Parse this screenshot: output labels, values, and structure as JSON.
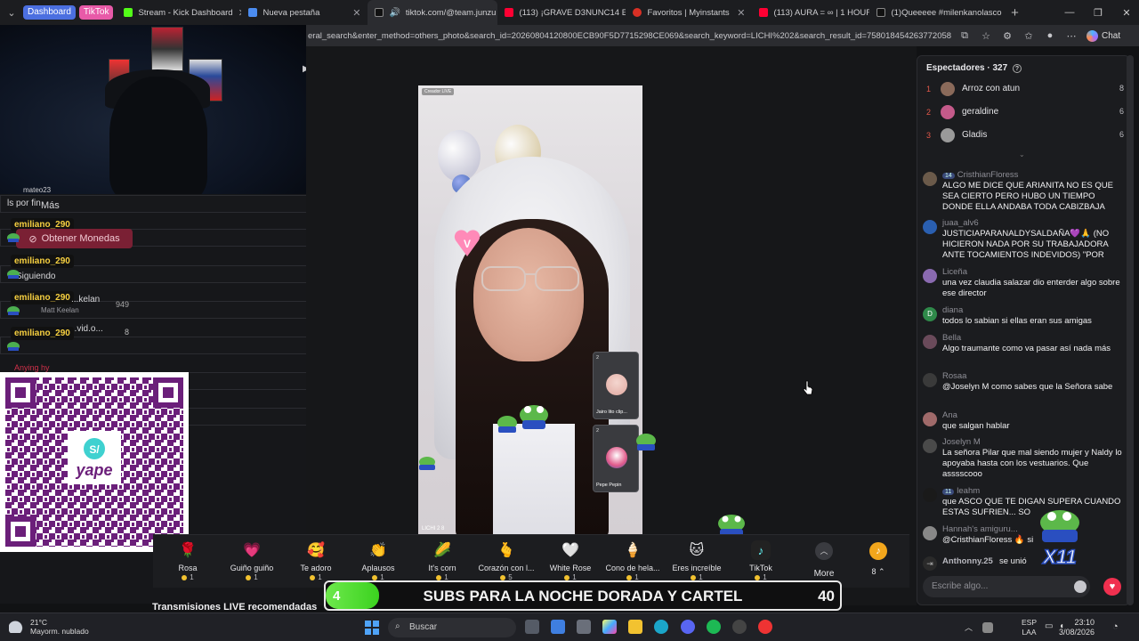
{
  "browser": {
    "tab_groups": [
      {
        "label": "Dashboard",
        "color": "#4b6fe0"
      },
      {
        "label": "TikTok",
        "color": "#e85aa8"
      }
    ],
    "tabs": [
      {
        "label": "Stream - Kick Dashboard",
        "fav": "#53fc18"
      },
      {
        "label": "Nueva pestaña",
        "fav": "#4b8cf0"
      },
      {
        "label": "tiktok.com/@team.junzu",
        "fav": "#111111",
        "active": true
      },
      {
        "label": "(113) ¡GRAVE D3NUNC14 EN",
        "fav": "#ff0033"
      },
      {
        "label": "Favoritos | Myinstants",
        "fav": "#d93025"
      },
      {
        "label": "(113) AURA = ∞ | 1 HOUR V",
        "fav": "#ff0033"
      },
      {
        "label": "(1)Queeeee #milenkanolasco",
        "fav": "#111111"
      }
    ],
    "url": "eral_search&enter_method=others_photo&search_id=20260804120800ECB90F5D7715298CE069&search_keyword=LICHI%202&search_result_id=7580184542637720584&sear...",
    "chat_label": "Chat"
  },
  "overlay": {
    "chat_names": [
      "emiliano_290",
      "emiliano_290",
      "emiliano_290",
      "emiliano_290"
    ],
    "ghost_texts": [
      "ls por fin",
      "Más",
      "Siguiendo",
      "Matt Keelan",
      "949",
      "8",
      "Arroz con atun",
      "Anying hy",
      "8"
    ],
    "coins_button": "Obtener Monedas",
    "partial_names": [
      "mateo23",
      "...kelan",
      "...vid.o..."
    ]
  },
  "video": {
    "creator_tag": "Creador LIVE",
    "handle": "LICHI 2 8",
    "guests": [
      {
        "name": "Jairo lito clip...",
        "count": "2"
      },
      {
        "name": "Pepe Pepin",
        "count": "2"
      }
    ]
  },
  "gifts": [
    {
      "name": "Rosa",
      "price": "1",
      "icon": "🌹"
    },
    {
      "name": "Guiño guiño",
      "price": "1",
      "icon": "💗"
    },
    {
      "name": "Te adoro",
      "price": "1",
      "icon": "🥰"
    },
    {
      "name": "Aplausos",
      "price": "1",
      "icon": "👏"
    },
    {
      "name": "It's corn",
      "price": "1",
      "icon": "🌽"
    },
    {
      "name": "Corazón con l...",
      "price": "5",
      "icon": "🫰"
    },
    {
      "name": "White Rose",
      "price": "1",
      "icon": "🤍"
    },
    {
      "name": "Cono de hela...",
      "price": "1",
      "icon": "🍦"
    },
    {
      "name": "Eres increíble",
      "price": "1",
      "icon": "🐱"
    },
    {
      "name": "TikTok",
      "price": "1",
      "icon": "♪"
    }
  ],
  "gift_more_label": "More",
  "coin_balance": "8",
  "recommended_label": "Transmisiones LIVE recomendadas",
  "subs_banner": {
    "count": "4",
    "text": "SUBS PARA LA NOCHE DORADA Y CARTEL",
    "goal": "40",
    "progress": 0.1
  },
  "viewers": {
    "title": "Espectadores · 327",
    "top": [
      {
        "rank": "1",
        "name": "Arroz con atun",
        "score": "8",
        "color": "#8a6a5a"
      },
      {
        "rank": "2",
        "name": "geraldine",
        "score": "6",
        "color": "#c45a8a"
      },
      {
        "rank": "3",
        "name": "Gladis",
        "score": "6",
        "color": "#9a9a9a"
      }
    ]
  },
  "chat": [
    {
      "user": "CristhianFloress",
      "badge": "14",
      "text": "ALGO ME DICE QUE ARIANITA NO ES QUE SEA CIERTO PERO HUBO UN TIEMPO DONDE ELLA ANDABA TODA CABIZBAJA",
      "color": "#6b5a4a"
    },
    {
      "user": "juaa_alv6",
      "badge": "",
      "text": "JUSTICIAPARANALDYSALDAÑA💜🙏 (NO HICIERON NADA POR SU TRABAJADORA ANTE TOCAMIENTOS INDEVIDOS) \"POR",
      "color": "#2a5fb0"
    },
    {
      "user": "Liceña",
      "badge": "",
      "text": "una vez claudia salazar dio enterder algo sobre ese director",
      "color": "#8a6ab0"
    },
    {
      "user": "diana",
      "badge": "",
      "text": "todos lo sabian si ellas eran sus amigas",
      "color": "#2f8a4a"
    },
    {
      "user": "Bella",
      "badge": "",
      "text": "Algo traumante como va pasar así nada más",
      "color": "#6a4a5a"
    },
    {
      "user": "Rosaa",
      "badge": "",
      "text": "@Joselyn M como sabes que la Señora sabe",
      "color": "#3a3a3a"
    },
    {
      "user": "Ana",
      "badge": "",
      "text": "que salgan hablar",
      "color": "#a06a6a"
    },
    {
      "user": "Joselyn M",
      "badge": "",
      "text": "La señora Pilar que mal siendo mujer y Naldy lo apoyaba hasta con los vestuarios. Que asssscooo",
      "color": "#4a4a4a"
    },
    {
      "user": "leahm",
      "badge": "11",
      "text": "que ASCO QUE TE DIGAN SUPERA CUANDO ESTAS SUFRIEN... SO",
      "color": "#1a1a1a"
    },
    {
      "user": "Hannah's amiguru...",
      "badge": "",
      "text": "@CristhianFloress 🔥 si",
      "color": "#888888"
    },
    {
      "user": "Anthonny.25",
      "badge": "",
      "text": "se unió",
      "color": "#2a2a2a"
    }
  ],
  "chat_input_placeholder": "Escribe algo...",
  "frog_label": "X11",
  "taskbar": {
    "weather_temp": "21°C",
    "weather_desc": "Mayorm. nublado",
    "search_placeholder": "Buscar",
    "lang_top": "ESP",
    "lang_bottom": "LAA",
    "time": "23:10",
    "date": "3/08/2026"
  }
}
